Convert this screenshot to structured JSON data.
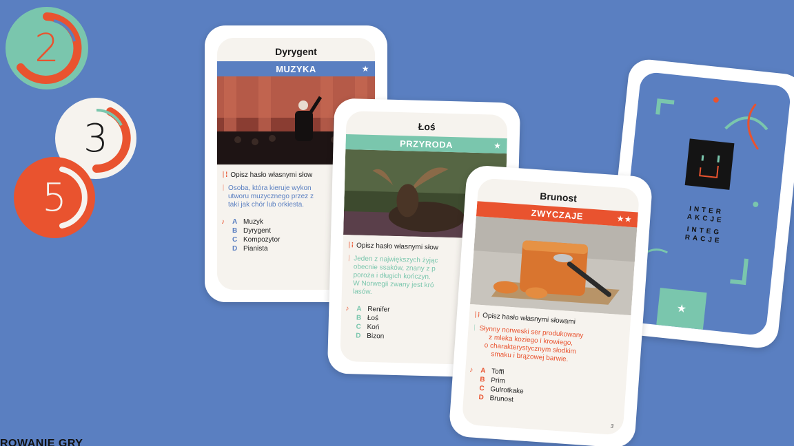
{
  "tokens": [
    {
      "number": "2",
      "bg": "#7ac6ad",
      "fg": "#e9532f"
    },
    {
      "number": "3",
      "bg": "#f6f3ee",
      "fg": "#e9532f"
    },
    {
      "number": "5",
      "bg": "#e9532f",
      "fg": "#f6f3ee"
    }
  ],
  "cards": [
    {
      "title": "Dyrygent",
      "category": "MUZYKA",
      "stars": "★",
      "color": "#5a7fc1",
      "prompt": "Opisz hasło własnymi słow",
      "description": "Osoba, która kieruje wykon\nutworu muzycznego przez z\ntaki jak chór lub orkiesta.",
      "answers": [
        {
          "letter": "A",
          "text": "Muzyk"
        },
        {
          "letter": "B",
          "text": "Dyrygent"
        },
        {
          "letter": "C",
          "text": "Kompozytor"
        },
        {
          "letter": "D",
          "text": "Pianista"
        }
      ]
    },
    {
      "title": "Łoś",
      "category": "PRZYRODA",
      "stars": "★",
      "color": "#7ac6ad",
      "prompt": "Opisz hasło własnymi słow",
      "description": "Jeden z największych żyjąc\nobecnie ssaków, znany z p\nporoża i długich kończyn.\nW Norwegii zwany jest kró\nlasów.",
      "answers": [
        {
          "letter": "A",
          "text": "Renifer"
        },
        {
          "letter": "B",
          "text": "Łoś"
        },
        {
          "letter": "C",
          "text": "Koń"
        },
        {
          "letter": "D",
          "text": "Bizon"
        }
      ]
    },
    {
      "title": "Brunost",
      "category": "ZWYCZAJE",
      "stars": "★★",
      "color": "#e9532f",
      "prompt": "Opisz hasło własnymi słowami",
      "description": "Słynny norweski ser produkowany\nz mleka koziego i krowiego,\no charakterystycznym słodkim\nsmaku i brązowej barwie.",
      "answers": [
        {
          "letter": "A",
          "text": "Toffi"
        },
        {
          "letter": "B",
          "text": "Prim"
        },
        {
          "letter": "C",
          "text": "Gulrotkake"
        },
        {
          "letter": "D",
          "text": "Brunost"
        }
      ],
      "page_number": "3"
    }
  ],
  "card_back": {
    "lines": [
      "INTER",
      "AKCJE",
      "INTEG",
      "RACJE"
    ],
    "star": "★"
  },
  "footer_text": "ROWANIE GRY"
}
